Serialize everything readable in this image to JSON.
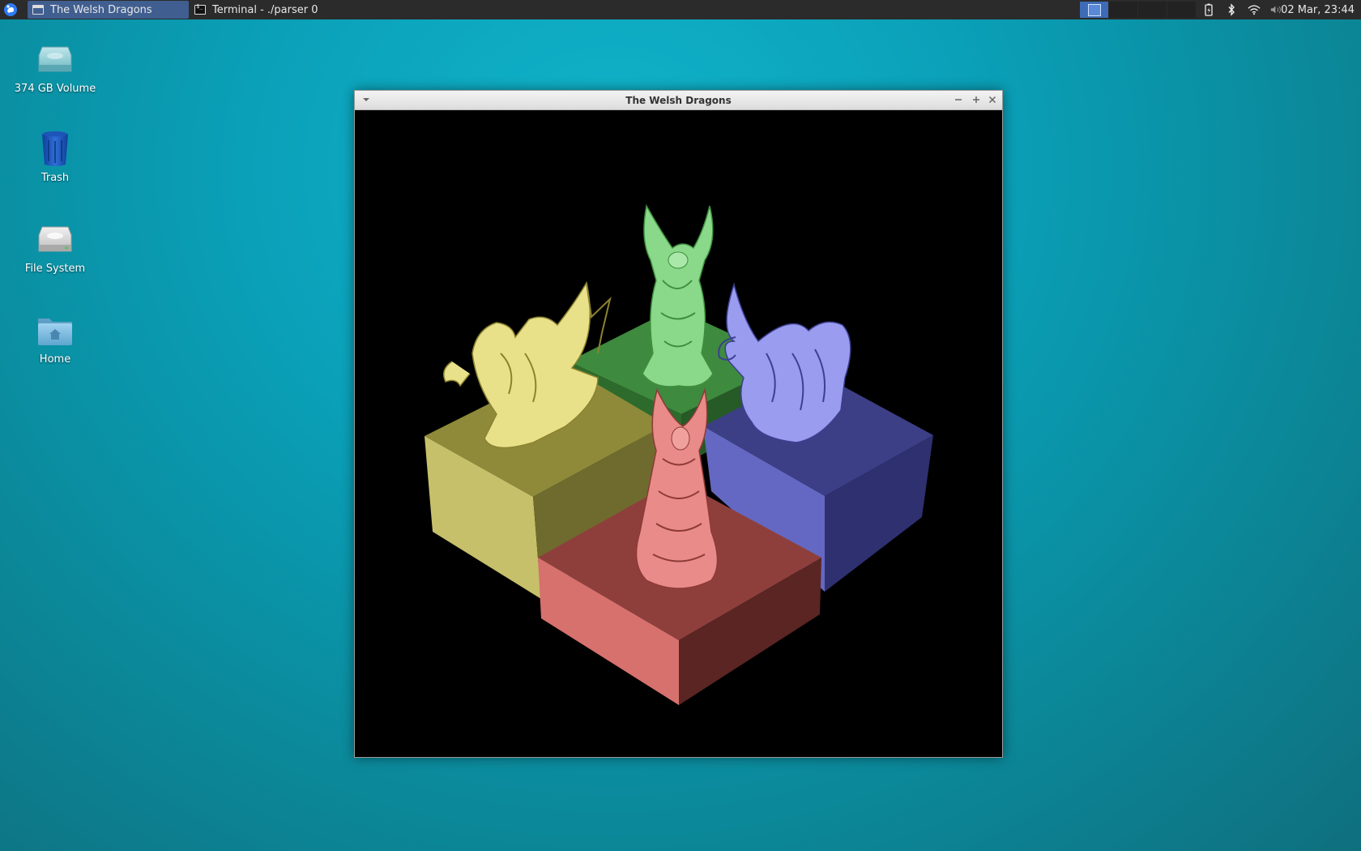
{
  "panel": {
    "tasks": [
      {
        "label": "The Welsh Dragons",
        "icon": "window-icon",
        "active": true
      },
      {
        "label": "Terminal - ./parser 0",
        "icon": "terminal-icon",
        "active": false
      }
    ],
    "clock": "02 Mar, 23:44",
    "workspaces": 4,
    "active_workspace": 1
  },
  "desktop": {
    "icons": [
      {
        "label": "374 GB Volume",
        "icon": "drive-icon"
      },
      {
        "label": "Trash",
        "icon": "trash-icon"
      },
      {
        "label": "File System",
        "icon": "harddisk-icon"
      },
      {
        "label": "Home",
        "icon": "home-folder-icon"
      }
    ]
  },
  "window": {
    "title": "The Welsh Dragons",
    "scene_colors": {
      "yellow": "#d8d06a",
      "green": "#5fb560",
      "blue": "#6f72cf",
      "red": "#d96a68"
    }
  }
}
